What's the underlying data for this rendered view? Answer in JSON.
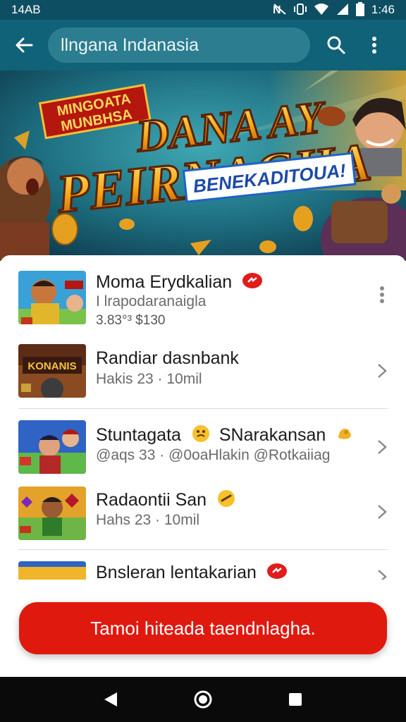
{
  "status_bar": {
    "time_left": "14AB",
    "time_right": "1:46"
  },
  "app_bar": {
    "search_value": "llngana Indanasia"
  },
  "banner": {
    "title_line1": "DANA AY",
    "title_line2": "PEIRNAGHA",
    "tag_top": "MINGOATA",
    "tag_bottom": "MUNBHSA",
    "subtitle": "BENEKADITOUA!"
  },
  "list": [
    {
      "title": "Moma Erydkalian",
      "subtitle": "I lrapodaranaigla",
      "meta": "3.83°³ $130",
      "badge": "red",
      "action": "more"
    },
    {
      "title": "Randiar dasnbank",
      "subtitle": "Hakis 23 · 10mil",
      "action": "chevron",
      "thumb_text": "KONANIS"
    },
    {
      "title": "Stuntagata",
      "title_extra": "SNarakansan",
      "subtitle": "@aqs 33 · @0oaHlakin @Rotkaiiag",
      "action": "chevron"
    },
    {
      "title": "Radaontii San",
      "subtitle": "Hahs 23 · 10mil",
      "action": "chevron"
    },
    {
      "title": "Bnsleran lentakarian",
      "badge": "red",
      "action": "chevron"
    }
  ],
  "cta": {
    "label": "Tamoi hiteada taendnlagha."
  },
  "colors": {
    "primary": "#0f6277",
    "status": "#0d4e63",
    "accent": "#e0190f"
  }
}
